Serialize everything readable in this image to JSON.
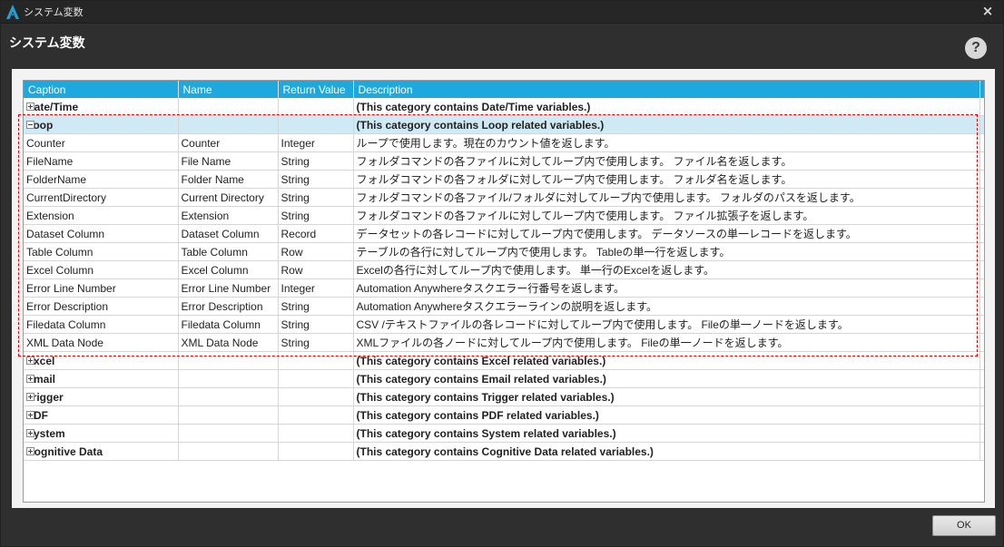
{
  "window": {
    "title": "システム変数",
    "page_title": "システム変数",
    "help_label": "?",
    "close_label": "×"
  },
  "grid": {
    "columns": [
      "Caption",
      "Name",
      "Return Value",
      "Description"
    ],
    "rows": [
      {
        "kind": "category",
        "expanded": false,
        "caption": "Date/Time",
        "desc": "(This category contains Date/Time variables.)"
      },
      {
        "kind": "category",
        "expanded": true,
        "caption": "Loop",
        "desc": "(This category contains Loop related variables.)"
      },
      {
        "kind": "item",
        "caption": "Counter",
        "name": "Counter",
        "ret": "Integer",
        "desc": "ループで使用します。現在のカウント値を返します。",
        "red": true
      },
      {
        "kind": "item",
        "caption": "FileName",
        "name": "File Name",
        "ret": "String",
        "desc": "フォルダコマンドの各ファイルに対してループ内で使用します。 ファイル名を返します。",
        "red": true
      },
      {
        "kind": "item",
        "caption": "FolderName",
        "name": "Folder Name",
        "ret": "String",
        "desc": "フォルダコマンドの各フォルダに対してループ内で使用します。 フォルダ名を返します。",
        "red": true
      },
      {
        "kind": "item",
        "caption": "CurrentDirectory",
        "name": "Current Directory",
        "ret": "String",
        "desc": "フォルダコマンドの各ファイル/フォルダに対してループ内で使用します。 フォルダのパスを返します。",
        "red": true
      },
      {
        "kind": "item",
        "caption": "Extension",
        "name": "Extension",
        "ret": "String",
        "desc": "フォルダコマンドの各ファイルに対してループ内で使用します。 ファイル拡張子を返します。",
        "red": true
      },
      {
        "kind": "item",
        "caption": "Dataset Column",
        "name": "Dataset Column",
        "ret": "Record",
        "desc": "データセットの各レコードに対してループ内で使用します。 データソースの単一レコードを返します。",
        "red": true
      },
      {
        "kind": "item",
        "caption": "Table Column",
        "name": "Table Column",
        "ret": "Row",
        "desc": "テーブルの各行に対してループ内で使用します。 Tableの単一行を返します。",
        "red": true
      },
      {
        "kind": "item",
        "caption": "Excel Column",
        "name": "Excel Column",
        "ret": "Row",
        "desc": "Excelの各行に対してループ内で使用します。 単一行のExcelを返します。",
        "red": true
      },
      {
        "kind": "item",
        "caption": "Error Line Number",
        "name": "Error Line Number",
        "ret": "Integer",
        "desc": "Automation Anywhereタスクエラー行番号を返します。",
        "red": false
      },
      {
        "kind": "item",
        "caption": "Error Description",
        "name": "Error Description",
        "ret": "String",
        "desc": "Automation Anywhereタスクエラーラインの説明を返します。",
        "red": false
      },
      {
        "kind": "item",
        "caption": "Filedata Column",
        "name": "Filedata Column",
        "ret": "String",
        "desc": "CSV /テキストファイルの各レコードに対してループ内で使用します。 Fileの単一ノードを返します。",
        "red": true
      },
      {
        "kind": "item",
        "caption": "XML Data Node",
        "name": "XML Data Node",
        "ret": "String",
        "desc": "XMLファイルの各ノードに対してループ内で使用します。 Fileの単一ノードを返します。",
        "red": true
      },
      {
        "kind": "category",
        "expanded": false,
        "caption": "Excel",
        "desc": "(This category contains Excel related variables.)"
      },
      {
        "kind": "category",
        "expanded": false,
        "caption": "Email",
        "desc": "(This category contains Email related variables.)"
      },
      {
        "kind": "category",
        "expanded": false,
        "caption": "Trigger",
        "desc": "(This category contains Trigger related variables.)"
      },
      {
        "kind": "category",
        "expanded": false,
        "caption": "PDF",
        "desc": "(This category contains PDF related variables.)"
      },
      {
        "kind": "category",
        "expanded": false,
        "caption": "System",
        "desc": "(This category contains System related variables.)"
      },
      {
        "kind": "category",
        "expanded": false,
        "caption": "Cognitive Data",
        "desc": "(This category contains Cognitive Data related variables.)"
      }
    ]
  },
  "footer": {
    "ok_label": "OK"
  },
  "colors": {
    "header_blue": "#1ea8de",
    "highlight_red": "#e30000",
    "selected_row": "#cfe9f5"
  }
}
